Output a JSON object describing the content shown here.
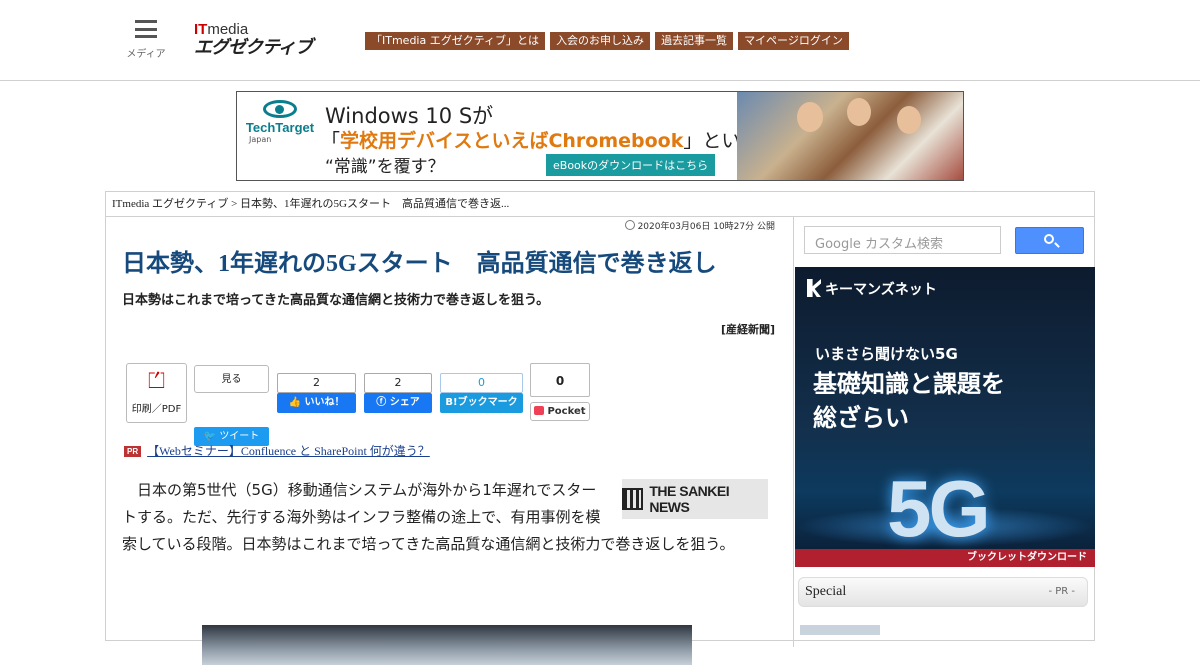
{
  "header": {
    "menu_label": "メディア",
    "logo_it": "IT",
    "logo_media": "media",
    "logo_brand": "エグゼクティブ",
    "nav": [
      "「ITmedia エグゼクティブ」とは",
      "入会のお申し込み",
      "過去記事一覧",
      "マイページログイン"
    ]
  },
  "banner": {
    "brand": "TechTarget",
    "brand_sub": "Japan",
    "line1": "Windows 10 Sが",
    "line2_pre": "「",
    "line2_highlight": "学校用デバイスといえばChromebook",
    "line2_post": "」という",
    "line3": "“常識”を覆す？",
    "cta": "eBookのダウンロードはこちら"
  },
  "breadcrumb": "ITmedia エグゼクティブ > 日本勢、1年遅れの5Gスタート　高品質通信で巻き返...",
  "article": {
    "date": "2020年03月06日 10時27分 公開",
    "title": "日本勢、1年遅れの5Gスタート　高品質通信で巻き返し",
    "lead": "日本勢はこれまで培ってきた高品質な通信網と技術力で巻き返しを狙う。",
    "source": "[産経新聞]",
    "share": {
      "pdf_label": "印刷／PDF",
      "twitter_count": "見る",
      "twitter_label": "ツイート",
      "like_count": "2",
      "like_label": "いいね！",
      "fb_count": "2",
      "fb_label": "シェア",
      "hatena_count": "0",
      "hatena_label": "B!ブックマーク",
      "pocket_count": "0",
      "pocket_label": "Pocket"
    },
    "pr_tag": "PR",
    "pr_link": "【Webセミナー】Confluence と SharePoint 何が違う？",
    "sankei_logo": "THE SANKEI NEWS",
    "body": "日本の第5世代（5G）移動通信システムが海外から1年遅れでスタートする。ただ、先行する海外勢はインフラ整備の途上で、有用事例を模索している段階。日本勢はこれまで培ってきた高品質な通信網と技術力で巻き返しを狙う。"
  },
  "sidebar": {
    "search_google": "Google",
    "search_placeholder": "カスタム検索",
    "ad": {
      "brand": "キーマンズネット",
      "line1": "いまさら聞けない5G",
      "line2": "基礎知識と課題を",
      "line3": "総ざらい",
      "big": "5G",
      "cta": "ブックレットダウンロード"
    },
    "special_title": "Special",
    "special_pr": "- PR -"
  }
}
